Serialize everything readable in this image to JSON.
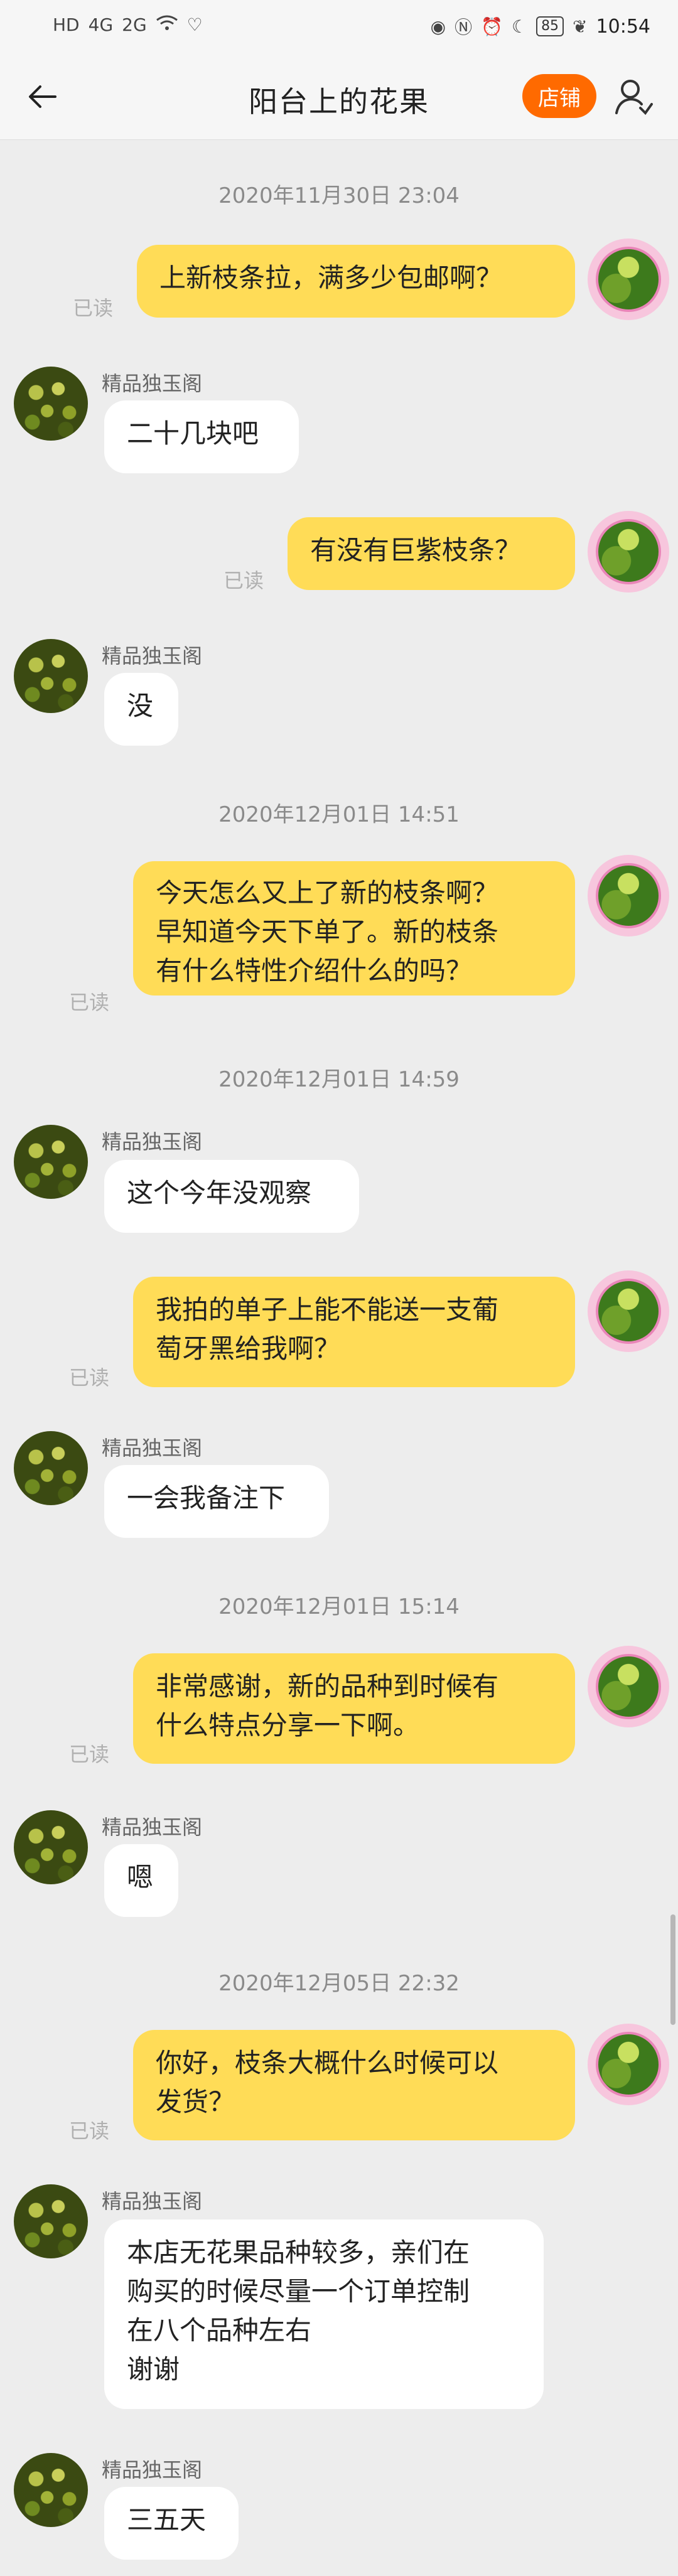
{
  "status_bar": {
    "left_icons": [
      "HD",
      "4G",
      "2G",
      "wifi-icon",
      "heart-icon"
    ],
    "right_icons": [
      "eye-icon",
      "nfc-icon",
      "alarm-icon",
      "moon-icon"
    ],
    "battery": "85",
    "time": "10:54"
  },
  "header": {
    "title": "阳台上的花果",
    "shop_label": "店铺"
  },
  "seller_name": "精品独玉阁",
  "read_label": "已读",
  "timestamps": [
    "2020年11月30日 23:04",
    "2020年12月01日 14:51",
    "2020年12月01日 14:59",
    "2020年12月01日 15:14",
    "2020年12月05日 22:32"
  ],
  "messages": [
    {
      "from": "me",
      "text": "上新枝条拉，满多少包邮啊？"
    },
    {
      "from": "seller",
      "text": "二十几块吧"
    },
    {
      "from": "me",
      "text": "有没有巨紫枝条？"
    },
    {
      "from": "seller",
      "text": "没"
    },
    {
      "from": "me",
      "text": "今天怎么又上了新的枝条啊？\n早知道今天下单了。新的枝条\n有什么特性介绍什么的吗？"
    },
    {
      "from": "seller",
      "text": "这个今年没观察"
    },
    {
      "from": "me",
      "text": "我拍的单子上能不能送一支葡\n萄牙黑给我啊？"
    },
    {
      "from": "seller",
      "text": "一会我备注下"
    },
    {
      "from": "me",
      "text": "非常感谢，新的品种到时候有\n什么特点分享一下啊。"
    },
    {
      "from": "seller",
      "text": "嗯"
    },
    {
      "from": "me",
      "text": "你好，枝条大概什么时候可以\n发货？"
    },
    {
      "from": "seller",
      "text": "本店无花果品种较多，亲们在\n购买的时候尽量一个订单控制\n在八个品种左右\n谢谢"
    },
    {
      "from": "seller",
      "text": "三五天"
    }
  ]
}
